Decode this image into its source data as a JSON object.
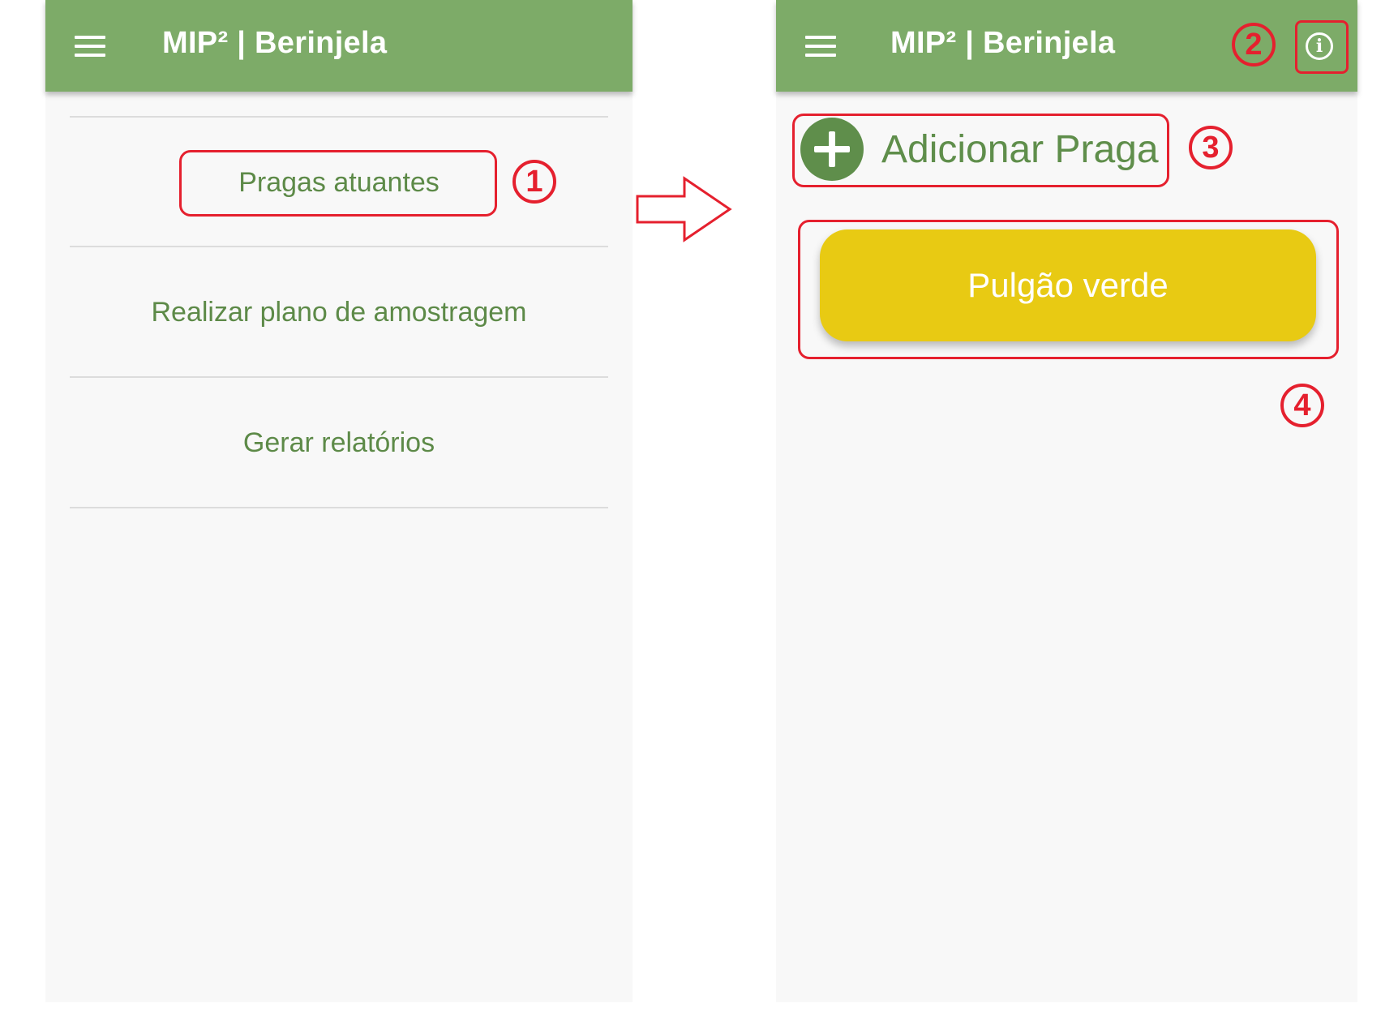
{
  "left_screen": {
    "appbar_title": "MIP² | Berinjela",
    "menu_items": [
      {
        "label": "Pragas atuantes"
      },
      {
        "label": "Realizar plano de amostragem"
      },
      {
        "label": "Gerar relatórios"
      }
    ]
  },
  "right_screen": {
    "appbar_title": "MIP² | Berinjela",
    "info_icon": "i",
    "add_pest_label": "Adicionar Praga",
    "pest_cards": [
      {
        "label": "Pulgão verde"
      }
    ]
  },
  "annotations": {
    "badge_1": "1",
    "badge_2": "2",
    "badge_3": "3",
    "badge_4": "4"
  },
  "colors": {
    "appbar": "#7dab68",
    "accent_text": "#5d8a48",
    "pest_card": "#e8ca13",
    "annotation": "#e5202e"
  }
}
